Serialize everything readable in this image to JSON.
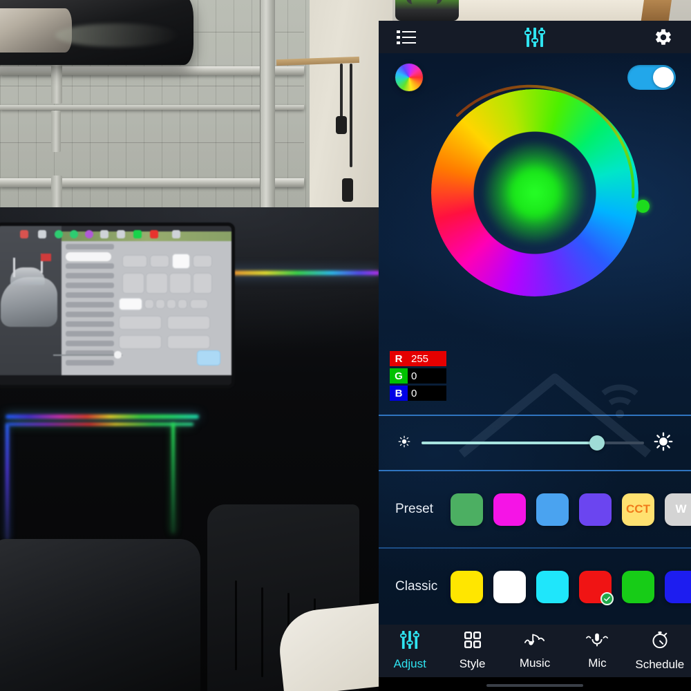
{
  "app": {
    "topbar": {
      "menu_icon": "list-icon",
      "title_icon": "sliders-icon",
      "settings_icon": "gear-icon"
    },
    "power": {
      "wheel_icon": "color-wheel-icon",
      "toggle_state": "on"
    },
    "color_picker": {
      "selected_color_hex": "#00ff00",
      "arc_handle_color_hex": "#1ddb1d",
      "center_glow_hex": "#26ff26",
      "rgb": [
        {
          "channel": "R",
          "value": "255",
          "tag_color": "#e50000",
          "value_bg": "#e50000"
        },
        {
          "channel": "G",
          "value": "0",
          "tag_color": "#00c000",
          "value_bg": "#000000"
        },
        {
          "channel": "B",
          "value": "0",
          "tag_color": "#0000e5",
          "value_bg": "#000000"
        }
      ]
    },
    "brightness": {
      "low_icon": "brightness-low-icon",
      "high_icon": "brightness-high-icon",
      "value_percent": 79,
      "fill_color": "#a7e3df",
      "thumb_color": "#9fdcd6"
    },
    "preset": {
      "label": "Preset",
      "swatches": [
        {
          "name": "preset-green",
          "color": "#4caf62",
          "text": "",
          "text_color": "",
          "selected": false
        },
        {
          "name": "preset-magenta",
          "color": "#f514e6",
          "text": "",
          "text_color": "",
          "selected": false
        },
        {
          "name": "preset-blue",
          "color": "#4aa3f0",
          "text": "",
          "text_color": "",
          "selected": false
        },
        {
          "name": "preset-purple",
          "color": "#6b45f0",
          "text": "",
          "text_color": "",
          "selected": false
        },
        {
          "name": "preset-cct",
          "color": "#ffe170",
          "text": "CCT",
          "text_color": "#f07a1a",
          "selected": false
        },
        {
          "name": "preset-white",
          "color": "#d4d4d4",
          "text": "W",
          "text_color": "#ffffff",
          "selected": false
        }
      ]
    },
    "classic": {
      "label": "Classic",
      "swatches": [
        {
          "name": "classic-yellow",
          "color": "#ffe600",
          "text": "",
          "text_color": "",
          "selected": false
        },
        {
          "name": "classic-white",
          "color": "#ffffff",
          "text": "",
          "text_color": "",
          "selected": false
        },
        {
          "name": "classic-cyan",
          "color": "#1fe6fb",
          "text": "",
          "text_color": "",
          "selected": false
        },
        {
          "name": "classic-red",
          "color": "#f01414",
          "text": "",
          "text_color": "",
          "selected": true
        },
        {
          "name": "classic-green",
          "color": "#17cc17",
          "text": "",
          "text_color": "",
          "selected": false
        },
        {
          "name": "classic-blue",
          "color": "#1d1df0",
          "text": "",
          "text_color": "",
          "selected": false
        }
      ]
    },
    "bottom_nav": {
      "active_color": "#2fe3f0",
      "items": [
        {
          "label": "Adjust",
          "icon": "sliders-icon",
          "active": true
        },
        {
          "label": "Style",
          "icon": "grid-icon",
          "active": false
        },
        {
          "label": "Music",
          "icon": "music-note-icon",
          "active": false
        },
        {
          "label": "Mic",
          "icon": "microphone-icon",
          "active": false
        },
        {
          "label": "Schedule",
          "icon": "stopwatch-icon",
          "active": false
        }
      ]
    }
  }
}
